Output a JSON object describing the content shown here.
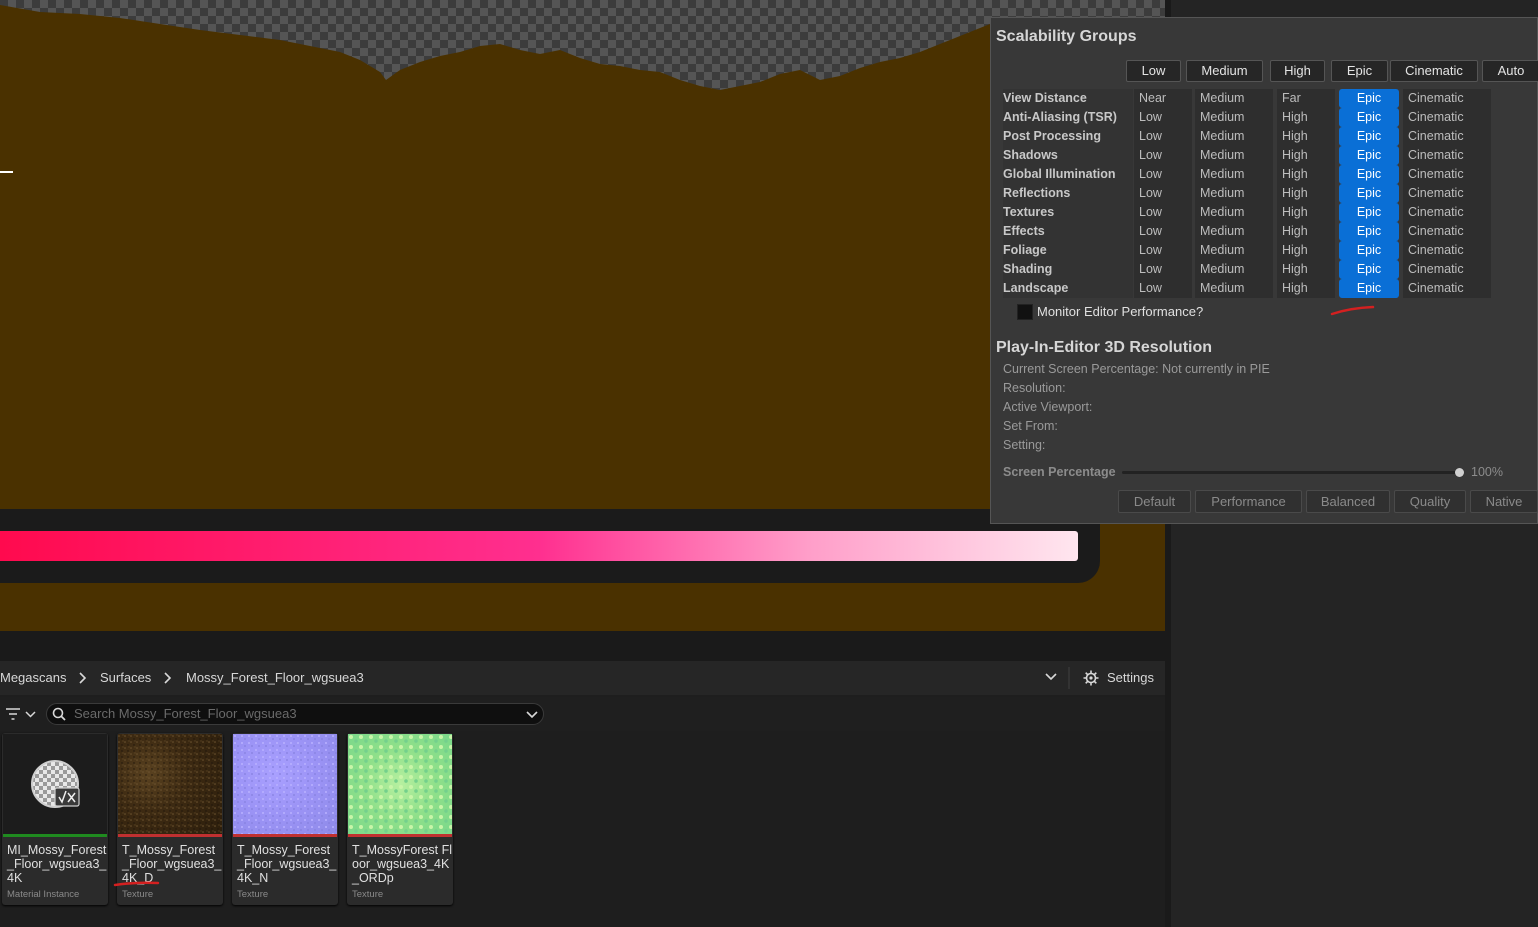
{
  "scalability": {
    "title": "Scalability Groups",
    "presets": [
      "Low",
      "Medium",
      "High",
      "Epic",
      "Cinematic",
      "Auto"
    ],
    "groups": [
      {
        "label": "View Distance",
        "options": [
          "Near",
          "Medium",
          "Far",
          "Epic",
          "Cinematic"
        ],
        "selected": "Epic"
      },
      {
        "label": "Anti-Aliasing (TSR)",
        "options": [
          "Low",
          "Medium",
          "High",
          "Epic",
          "Cinematic"
        ],
        "selected": "Epic"
      },
      {
        "label": "Post Processing",
        "options": [
          "Low",
          "Medium",
          "High",
          "Epic",
          "Cinematic"
        ],
        "selected": "Epic"
      },
      {
        "label": "Shadows",
        "options": [
          "Low",
          "Medium",
          "High",
          "Epic",
          "Cinematic"
        ],
        "selected": "Epic"
      },
      {
        "label": "Global Illumination",
        "options": [
          "Low",
          "Medium",
          "High",
          "Epic",
          "Cinematic"
        ],
        "selected": "Epic"
      },
      {
        "label": "Reflections",
        "options": [
          "Low",
          "Medium",
          "High",
          "Epic",
          "Cinematic"
        ],
        "selected": "Epic"
      },
      {
        "label": "Textures",
        "options": [
          "Low",
          "Medium",
          "High",
          "Epic",
          "Cinematic"
        ],
        "selected": "Epic"
      },
      {
        "label": "Effects",
        "options": [
          "Low",
          "Medium",
          "High",
          "Epic",
          "Cinematic"
        ],
        "selected": "Epic"
      },
      {
        "label": "Foliage",
        "options": [
          "Low",
          "Medium",
          "High",
          "Epic",
          "Cinematic"
        ],
        "selected": "Epic"
      },
      {
        "label": "Shading",
        "options": [
          "Low",
          "Medium",
          "High",
          "Epic",
          "Cinematic"
        ],
        "selected": "Epic"
      },
      {
        "label": "Landscape",
        "options": [
          "Low",
          "Medium",
          "High",
          "Epic",
          "Cinematic"
        ],
        "selected": "Epic"
      }
    ],
    "monitor_label": "Monitor Editor Performance?",
    "monitor_checked": false
  },
  "pie": {
    "title": "Play-In-Editor 3D Resolution",
    "lines": [
      "Current Screen Percentage: Not currently in PIE",
      "Resolution:",
      "Active Viewport:",
      "Set From:",
      "Setting:"
    ],
    "screen_percentage_label": "Screen Percentage",
    "screen_percentage_value": "100%",
    "screen_percentage_fraction": 1.0,
    "buttons": [
      "Default",
      "Performance",
      "Balanced",
      "Quality",
      "Native"
    ]
  },
  "content_browser": {
    "breadcrumbs": [
      "Megascans",
      "Surfaces",
      "Mossy_Forest_Floor_wgsuea3"
    ],
    "settings_label": "Settings",
    "search_placeholder": "Search Mossy_Forest_Floor_wgsuea3",
    "assets": [
      {
        "name": "MI_Mossy_Forest_Floor_wgsuea3_4K",
        "type": "Material Instance",
        "strip_color": "#1f8a1f",
        "thumb": "material-instance-icon"
      },
      {
        "name": "T_Mossy_Forest_Floor_wgsuea3_4K_D",
        "type": "Texture",
        "strip_color": "#c03030",
        "thumb": "diffuse-texture"
      },
      {
        "name": "T_Mossy_Forest_Floor_wgsuea3_4K_N",
        "type": "Texture",
        "strip_color": "#c03030",
        "thumb": "normal-texture"
      },
      {
        "name": "T_MossyForest Floor_wgsuea3_4K_ORDp",
        "type": "Texture",
        "strip_color": "#c03030",
        "thumb": "ordp-texture"
      }
    ]
  },
  "colors": {
    "accent": "#0a6fd6",
    "viewport_ground": "#4a3100",
    "progress_start": "#ff0a4e",
    "progress_end": "#ffe6ef"
  }
}
